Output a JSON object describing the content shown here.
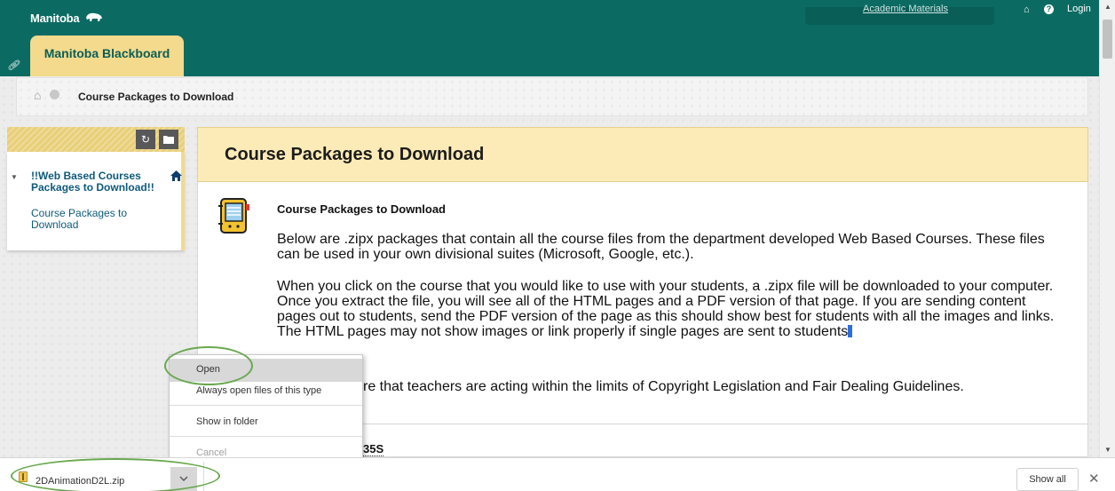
{
  "app": {
    "logo_text": "Manitoba",
    "tab_label": "Manitoba Blackboard",
    "top_links": {
      "academic": "Academic Materials",
      "login": "Login"
    }
  },
  "breadcrumb": {
    "current": "Course Packages to Download"
  },
  "course_menu": {
    "title": "!!Web Based Courses Packages to Download!!",
    "items": [
      {
        "label": "Course Packages to Download"
      }
    ]
  },
  "main": {
    "title": "Course Packages to Download",
    "item_title": "Course Packages to Download",
    "paragraph1": "Below are .zipx packages that contain all the course files from the department developed Web Based Courses. These files can be used in your own divisional suites (Microsoft, Google, etc.).",
    "paragraph2": "When you click on the course that you would like to use with your students, a .zipx file will be downloaded to your computer. Once you extract the file, you will see all of the HTML pages and a PDF version of that page. If you are sending content pages out to students, send the PDF version of the page as this should show best for students with all the images and links. The HTML pages may not show images or link properly if single pages are sent to students",
    "paragraph3_visible": "re that teachers are acting within the limits of Copyright Legislation and Fair Dealing Guidelines.",
    "next_item_visible": "35S"
  },
  "context_menu": {
    "items": [
      {
        "label": "Open",
        "state": "hover"
      },
      {
        "label": "Always open files of this type",
        "state": "normal"
      },
      {
        "label": "Show in folder",
        "state": "normal"
      },
      {
        "label": "Cancel",
        "state": "disabled"
      }
    ]
  },
  "download_bar": {
    "filename": "2DAnimationD2L.zip",
    "show_all": "Show all",
    "close": "✕"
  },
  "icons": {
    "menu_refresh": "↻",
    "menu_folder": "▬",
    "home": "⌂",
    "chevron_down": "⌄"
  },
  "colors": {
    "banner": "#0b6b63",
    "tab": "#f3da8c",
    "header": "#fcebb6",
    "annotation": "#69a84f"
  }
}
